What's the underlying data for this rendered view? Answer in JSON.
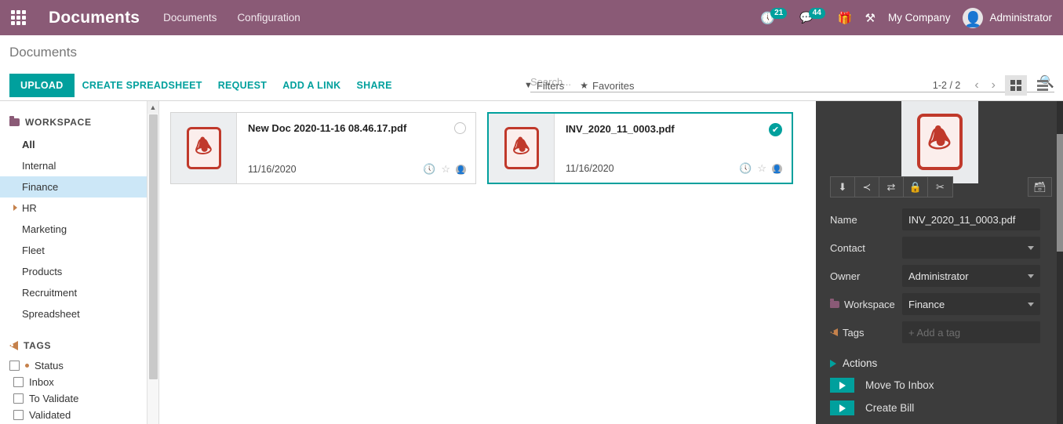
{
  "navbar": {
    "apps_icon": "apps-grid-icon",
    "brand": "Documents",
    "menu": [
      {
        "label": "Documents"
      },
      {
        "label": "Configuration"
      }
    ],
    "activity_icon": "clock-icon",
    "activity_count": "21",
    "messages_icon": "chat-icon",
    "messages_count": "44",
    "gift_icon": "gift-icon",
    "tools_icon": "tools-icon",
    "company": "My Company",
    "user": "Administrator",
    "bg_color": "#8A5A76",
    "accent_color": "#00A09D"
  },
  "control_panel": {
    "breadcrumb": "Documents",
    "search": {
      "value": "",
      "placeholder": "Search...",
      "icon": "search-icon"
    },
    "buttons": {
      "upload": "UPLOAD",
      "create_spreadsheet": "CREATE SPREADSHEET",
      "request": "REQUEST",
      "add_a_link": "ADD A LINK",
      "share": "SHARE"
    },
    "filters_label": "Filters",
    "favorites_label": "Favorites",
    "pager": "1-2 / 2",
    "prev_icon": "chevron-left-icon",
    "next_icon": "chevron-right-icon",
    "view_kanban": "kanban-view-icon",
    "view_list": "list-view-icon"
  },
  "sidebar": {
    "workspace_title": "WORKSPACE",
    "workspace_icon": "folder-icon",
    "workspaces": [
      {
        "label": "All",
        "bold": true,
        "selected": false,
        "expandable": false
      },
      {
        "label": "Internal",
        "bold": false,
        "selected": false,
        "expandable": false
      },
      {
        "label": "Finance",
        "bold": false,
        "selected": true,
        "expandable": false
      },
      {
        "label": "HR",
        "bold": false,
        "selected": false,
        "expandable": true
      },
      {
        "label": "Marketing",
        "bold": false,
        "selected": false,
        "expandable": false
      },
      {
        "label": "Fleet",
        "bold": false,
        "selected": false,
        "expandable": false
      },
      {
        "label": "Products",
        "bold": false,
        "selected": false,
        "expandable": false
      },
      {
        "label": "Recruitment",
        "bold": false,
        "selected": false,
        "expandable": false
      },
      {
        "label": "Spreadsheet",
        "bold": false,
        "selected": false,
        "expandable": false
      }
    ],
    "tags_title": "TAGS",
    "tags_icon": "tag-icon",
    "tags": [
      {
        "label": "Status",
        "child": false,
        "dot": true
      },
      {
        "label": "Inbox",
        "child": true,
        "dot": false
      },
      {
        "label": "To Validate",
        "child": true,
        "dot": false
      },
      {
        "label": "Validated",
        "child": true,
        "dot": false
      }
    ],
    "scroll_up_icon": "chevron-up-icon"
  },
  "documents": [
    {
      "name": "New Doc 2020-11-16 08.46.17.pdf",
      "date": "11/16/2020",
      "file_icon": "pdf-file-icon",
      "selected": false,
      "icons": {
        "clock": "clock-icon",
        "star": "star-icon",
        "avatar": "avatar-icon"
      }
    },
    {
      "name": "INV_2020_11_0003.pdf",
      "date": "11/16/2020",
      "file_icon": "pdf-file-icon",
      "selected": true,
      "icons": {
        "clock": "clock-icon",
        "star": "star-icon",
        "avatar": "avatar-icon"
      }
    }
  ],
  "inspector": {
    "preview_icon": "pdf-file-icon",
    "toolbar": [
      {
        "icon": "download-icon",
        "glyph": "⤓"
      },
      {
        "icon": "share-icon",
        "glyph": "≺"
      },
      {
        "icon": "replace-icon",
        "glyph": "⇄"
      },
      {
        "icon": "lock-icon",
        "glyph": "ὑ2"
      },
      {
        "icon": "split-scissors-icon",
        "glyph": "✂"
      }
    ],
    "archive_icon": "archive-icon",
    "fields": [
      {
        "label": "Name",
        "value": "INV_2020_11_0003.pdf",
        "type": "text",
        "icon": null
      },
      {
        "label": "Contact",
        "value": "",
        "type": "dropdown",
        "icon": null
      },
      {
        "label": "Owner",
        "value": "Administrator",
        "type": "dropdown",
        "icon": null
      },
      {
        "label": "Workspace",
        "value": "Finance",
        "type": "dropdown",
        "icon": "folder-icon"
      },
      {
        "label": "Tags",
        "value": "+ Add a tag",
        "type": "placeholder",
        "icon": "tag-icon"
      }
    ],
    "actions_title": "Actions",
    "actions": [
      {
        "label": "Move To Inbox"
      },
      {
        "label": "Create Bill"
      }
    ]
  }
}
